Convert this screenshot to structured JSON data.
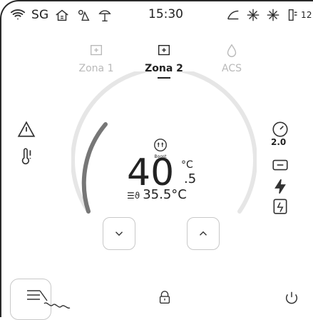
{
  "status": {
    "left_text": "SG",
    "time": "15:30",
    "right_text": "12"
  },
  "tabs": [
    {
      "label": "Zona 1",
      "active": false,
      "icon": "zone-icon"
    },
    {
      "label": "Zona 2",
      "active": true,
      "icon": "zone-icon"
    },
    {
      "label": "ACS",
      "active": false,
      "icon": "water-drop-icon"
    }
  ],
  "center": {
    "boost_label": "Boost",
    "temperature_main": "40",
    "temperature_unit": "°C",
    "temperature_decimal": ".5",
    "target_text": "35.5°C"
  },
  "right_side": {
    "gauge_value": "2.0"
  },
  "colors": {
    "arc_active": "#777777",
    "arc_inactive": "#e6e6e6",
    "tab_inactive": "#b9b9b9",
    "text": "#222222"
  }
}
